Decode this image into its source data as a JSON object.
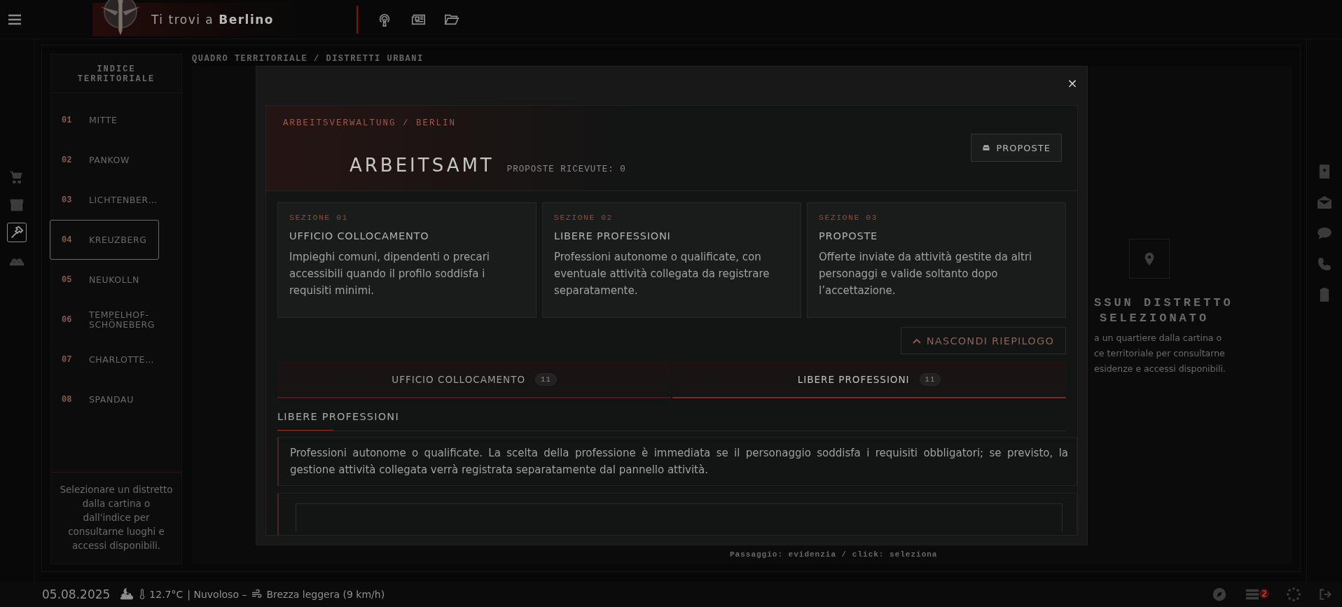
{
  "topbar": {
    "location_prefix": "Ti trovi a",
    "location": "Berlino",
    "tools": [
      {
        "kind": "broadcast"
      },
      {
        "kind": "newspaper"
      },
      {
        "kind": "folder"
      }
    ]
  },
  "left_nav": [
    {
      "kind": "cart",
      "selected": false
    },
    {
      "kind": "archive",
      "selected": false
    },
    {
      "kind": "hammer",
      "selected": true
    },
    {
      "kind": "users",
      "selected": false
    }
  ],
  "right_nav": [
    {
      "kind": "contact"
    },
    {
      "kind": "mail"
    },
    {
      "kind": "chat"
    },
    {
      "kind": "phone"
    },
    {
      "kind": "clipboard"
    }
  ],
  "sidebar": {
    "title": "INDICE TERRITORIALE",
    "items": [
      {
        "number": "01",
        "name": "MITTE",
        "selected": false
      },
      {
        "number": "02",
        "name": "PANKOW",
        "selected": false
      },
      {
        "number": "03",
        "name": "LICHTENBER…",
        "selected": false
      },
      {
        "number": "04",
        "name": "KREUZBERG",
        "selected": true
      },
      {
        "number": "05",
        "name": "NEUKOLLN",
        "selected": false
      },
      {
        "number": "06",
        "name": "TEMPELHOF-SCHÖNEBERG",
        "selected": false
      },
      {
        "number": "07",
        "name": "CHARLOTTE…",
        "selected": false
      },
      {
        "number": "08",
        "name": "SPANDAU",
        "selected": false
      }
    ],
    "hint": "Selezionare un distretto dalla cartina o dall'indice per consultarne luoghi e accessi disponibili."
  },
  "content": {
    "breadcrumb": "QUADRO TERRITORIALE / DISTRETTI URBANI",
    "empty_title": [
      "SSUN DISTRETTO",
      "SELEZIONATO"
    ],
    "empty_text": [
      "a un quartiere dalla cartina o",
      "ce territoriale per consultarne",
      "esidenze e accessi disponibili."
    ],
    "map_hint": "Passaggio: evidenzia / click: seleziona"
  },
  "modal": {
    "close": "×",
    "kicker": "ARBEITSVERWALTUNG / BERLIN",
    "title": "ARBEITSAMT",
    "counter_label": "PROPOSTE RICEVUTE:",
    "counter": "0",
    "proposals_button": "PROPOSTE",
    "cards": [
      {
        "section": "SEZIONE 01",
        "title": "UFFICIO COLLOCAMENTO",
        "text": "Impieghi comuni, dipendenti o precari accessibili quando il profilo soddisfa i requisiti minimi."
      },
      {
        "section": "SEZIONE 02",
        "title": "LIBERE PROFESSIONI",
        "text": "Professioni autonome o qualificate, con eventuale attività collegata da registrare separatamente."
      },
      {
        "section": "SEZIONE 03",
        "title": "PROPOSTE",
        "text": "Offerte inviate da attività gestite da altri personaggi e valide soltanto dopo l’accettazione."
      }
    ],
    "toggle_button": "NASCONDI RIEPILOGO",
    "tabs": [
      {
        "label": "UFFICIO COLLOCAMENTO",
        "count": "11",
        "selected": false
      },
      {
        "label": "LIBERE PROFESSIONI",
        "count": "11",
        "selected": true
      }
    ],
    "section_title": "LIBERE PROFESSIONI",
    "description": "Professioni autonome o qualificate. La scelta della professione è immediata se il personaggio soddisfa i requisiti obbligatori; se previsto, la gestione attività collegata verrà registrata separatamente dal pannello attività."
  },
  "statusbar": {
    "date": "05.08.2025",
    "temperature": "12.7°C",
    "weather": "| Nuvoloso –",
    "wind": "Brezza leggera (9 km/h)",
    "notification_count": "2"
  }
}
